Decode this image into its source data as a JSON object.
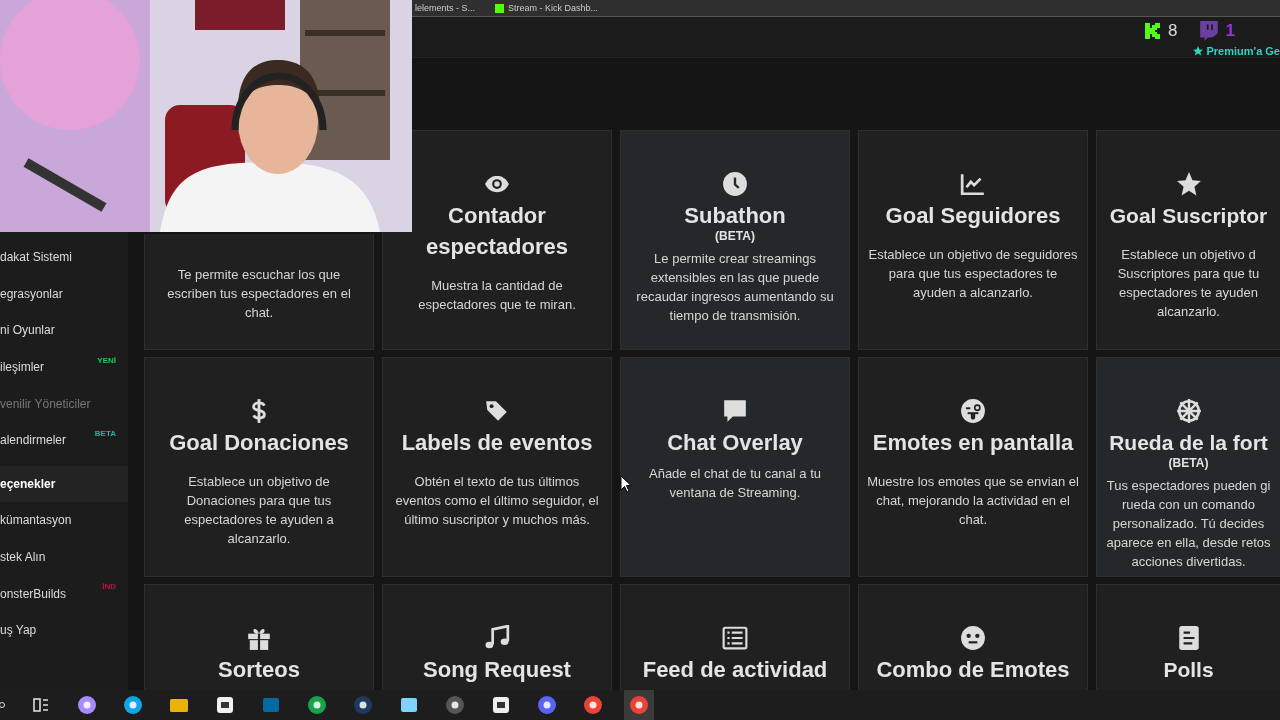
{
  "browser_tabs": [
    {
      "title": "lelements - S...",
      "selected": false
    },
    {
      "title": "Stream - Kick Dashb...",
      "selected": false
    }
  ],
  "header": {
    "kick_count": "8",
    "twitch_count": "1",
    "premium_link": "Premium'a Ge"
  },
  "sidebar": {
    "items": [
      {
        "label": "dakat Sistemi",
        "selected": false,
        "disabled": false
      },
      {
        "label": "egrasyonlar",
        "selected": false,
        "disabled": false
      },
      {
        "label": "ni Oyunlar",
        "selected": false,
        "disabled": false
      },
      {
        "label": "ileşimler",
        "selected": false,
        "disabled": false,
        "badge": "YENİ",
        "color": "#22c55e"
      },
      {
        "label": "venilir Yöneticiler",
        "selected": false,
        "disabled": true
      },
      {
        "label": "alendirmeler",
        "selected": false,
        "disabled": false,
        "badge": "BETA",
        "color": "#14b8a6"
      },
      {
        "label": "eçenekler",
        "selected": true,
        "disabled": false
      },
      {
        "label": "kümantasyon",
        "selected": false,
        "disabled": false
      },
      {
        "label": "stek Alın",
        "selected": false,
        "disabled": false
      },
      {
        "label": "onsterBuilds",
        "selected": false,
        "disabled": false,
        "badge": "İND",
        "color": "#be123c"
      },
      {
        "label": "uş Yap",
        "selected": false,
        "disabled": false
      }
    ]
  },
  "cards": [
    {
      "description": "Te permite escuchar los que escriben tus espectadores en el chat.",
      "highlighted": false
    },
    {
      "title": "Contador espectadores",
      "description": "Muestra la cantidad de espectadores que te miran.",
      "highlighted": false
    },
    {
      "title": "Subathon",
      "badge": "(BETA)",
      "description": "Le permite crear streamings extensibles en las que puede recaudar ingresos aumentando su tiempo de transmisión.",
      "highlighted": true
    },
    {
      "title": "Goal Seguidores",
      "description": "Establece un objetivo de seguidores para que tus espectadores te ayuden a alcanzarlo.",
      "highlighted": false
    },
    {
      "title": "Goal Suscriptor",
      "description": "Establece un objetivo d\nSuscriptores para que tu\nespectadores te ayuden\nalcanzarlo.",
      "highlighted": false
    },
    {
      "title": "Goal Donaciones",
      "description": "Establece un objetivo de Donaciones para que tus espectadores te ayuden a alcanzarlo.",
      "highlighted": false
    },
    {
      "title": "Labels de eventos",
      "description": "Obtén el texto de tus últimos eventos como el último seguidor, el último suscriptor y muchos más.",
      "highlighted": false
    },
    {
      "title": "Chat Overlay",
      "description": "Añade el chat de tu canal a tu ventana de Streaming.",
      "highlighted": true
    },
    {
      "title": "Emotes en pantalla",
      "description": "Muestre los emotes que se envian el chat, mejorando la actividad en el chat.",
      "highlighted": false
    },
    {
      "title": "Rueda de la fort",
      "badge": "(BETA)",
      "description": "Tus espectadores pueden gi\nrueda con un comando\npersonalizado. Tú decides\naparece en ella, desde retos\nacciones divertidas.",
      "highlighted": true
    },
    {
      "title": "Sorteos"
    },
    {
      "title": "Song Request"
    },
    {
      "title": "Feed de actividad"
    },
    {
      "title": "Combo de Emotes"
    },
    {
      "title": "Polls"
    }
  ],
  "taskbar": {
    "items": [
      {
        "selected": false
      },
      {
        "selected": false
      },
      {
        "selected": false
      },
      {
        "selected": false
      },
      {
        "selected": false
      },
      {
        "selected": false
      },
      {
        "selected": false
      },
      {
        "selected": false
      },
      {
        "selected": false
      },
      {
        "selected": false
      },
      {
        "selected": false
      },
      {
        "selected": false
      },
      {
        "selected": false
      },
      {
        "selected": false
      },
      {
        "selected": true
      }
    ]
  }
}
